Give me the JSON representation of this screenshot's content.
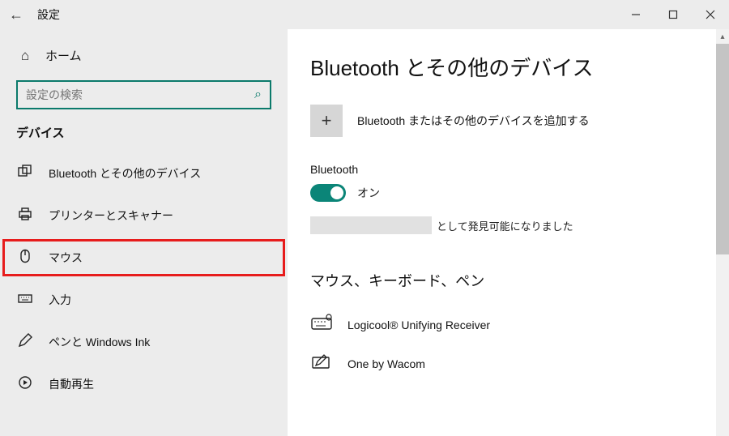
{
  "window": {
    "title": "設定"
  },
  "sidebar": {
    "home_label": "ホーム",
    "search_placeholder": "設定の検索",
    "section_label": "デバイス",
    "items": [
      {
        "label": "Bluetooth とその他のデバイス"
      },
      {
        "label": "プリンターとスキャナー"
      },
      {
        "label": "マウス"
      },
      {
        "label": "入力"
      },
      {
        "label": "ペンと Windows Ink"
      },
      {
        "label": "自動再生"
      }
    ]
  },
  "main": {
    "page_title": "Bluetooth とその他のデバイス",
    "add_label": "Bluetooth またはその他のデバイスを追加する",
    "bt_label": "Bluetooth",
    "bt_state": "オン",
    "discover_suffix": "として発見可能になりました",
    "sub_heading": "マウス、キーボード、ペン",
    "devices": [
      {
        "name": "Logicool® Unifying Receiver"
      },
      {
        "name": "One by Wacom"
      }
    ]
  }
}
